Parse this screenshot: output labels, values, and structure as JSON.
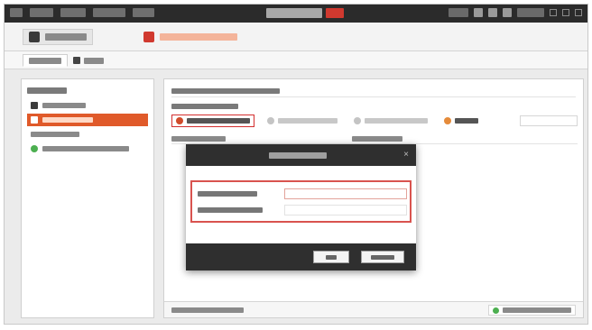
{
  "window": {
    "title_text": "",
    "version_text": ""
  },
  "menubar": {
    "items": [
      {
        "label": ""
      },
      {
        "label": ""
      },
      {
        "label": ""
      },
      {
        "label": ""
      },
      {
        "label": ""
      }
    ],
    "status": {
      "left_text": "",
      "time_text": ""
    }
  },
  "toolbar": {
    "tabs": [
      {
        "label": "",
        "icon": "document-icon"
      },
      {
        "label": "",
        "icon": "panel-icon"
      }
    ]
  },
  "subtabs": [
    {
      "label": ""
    },
    {
      "label": ""
    }
  ],
  "sidebar": {
    "title": "",
    "items": [
      {
        "label": "",
        "icon": "device-icon"
      },
      {
        "label": "",
        "icon": "device-icon",
        "selected": true
      },
      {
        "label": ""
      },
      {
        "label": "",
        "icon": "add-icon"
      }
    ]
  },
  "main": {
    "header": "",
    "subheader": "",
    "actions": [
      {
        "label": "",
        "icon": "add-icon"
      },
      {
        "label": "",
        "icon": "generic-icon"
      },
      {
        "label": "",
        "icon": "generic-icon"
      },
      {
        "label": "",
        "icon": "export-icon"
      }
    ],
    "search": {
      "placeholder": ""
    },
    "columns": [
      "",
      ""
    ],
    "footer": {
      "left_text": "",
      "right_label": ""
    }
  },
  "modal": {
    "title": "",
    "fields": [
      {
        "label": "",
        "value": ""
      },
      {
        "label": "",
        "value": ""
      }
    ],
    "buttons": {
      "ok": "",
      "cancel": ""
    }
  },
  "colors": {
    "accent": "#e05a2a",
    "highlight_border": "#d32f2f",
    "dark_bar": "#2b2b2b",
    "modal_bg": "#2f2f2f"
  }
}
